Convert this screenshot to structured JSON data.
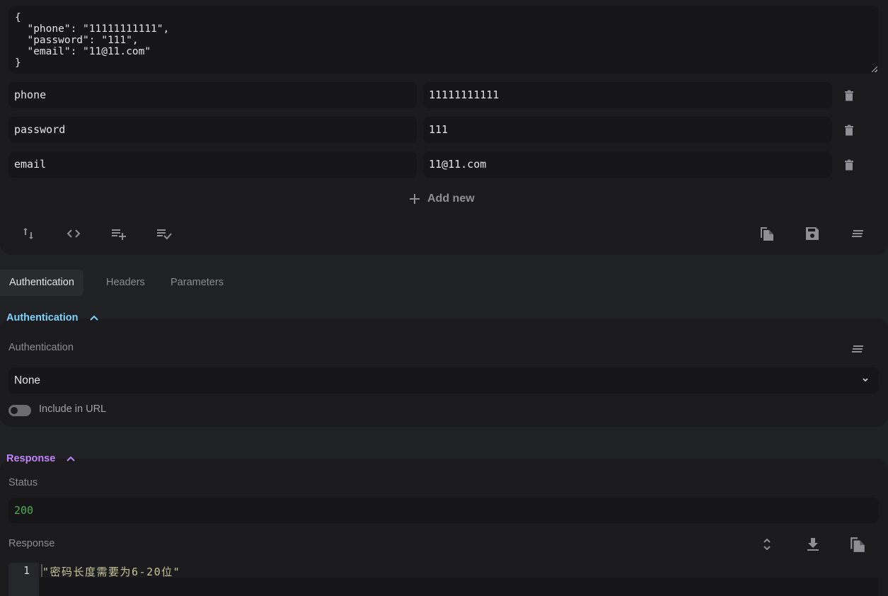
{
  "body_editor": {
    "json_text": "{\n  \"phone\": \"11111111111\",\n  \"password\": \"111\",\n  \"email\": \"11@11.com\"\n}",
    "pairs": [
      {
        "key": "phone",
        "value": "11111111111"
      },
      {
        "key": "password",
        "value": "111"
      },
      {
        "key": "email",
        "value": "11@11.com"
      }
    ],
    "add_new_label": "Add new",
    "toolbar_left": [
      "swap-vertical-icon",
      "code-icon",
      "playlist-add-icon",
      "playlist-check-icon"
    ],
    "toolbar_right": [
      "copy-icon",
      "save-icon",
      "wrap-text-icon"
    ]
  },
  "tabs": [
    {
      "label": "Authentication",
      "active": true
    },
    {
      "label": "Headers",
      "active": false
    },
    {
      "label": "Parameters",
      "active": false
    }
  ],
  "auth_section": {
    "title": "Authentication",
    "title_color": "#7dd3fc",
    "field_label": "Authentication",
    "selected": "None",
    "toggle_label": "Include in URL",
    "toggle_on": false
  },
  "response_section": {
    "title": "Response",
    "title_color": "#c084fc",
    "status_label": "Status",
    "status_value": "200",
    "status_color": "#4caf50",
    "response_label": "Response",
    "lines": [
      {
        "number": "1",
        "text": "\"密码长度需要为6-20位\""
      }
    ]
  }
}
